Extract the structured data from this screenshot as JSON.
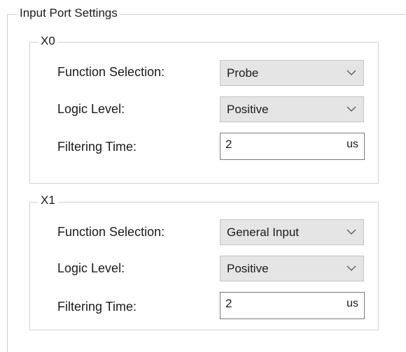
{
  "panel": {
    "title": "Input Port Settings"
  },
  "groups": [
    {
      "name": "X0",
      "function_label": "Function Selection:",
      "function_value": "Probe",
      "logic_label": "Logic Level:",
      "logic_value": "Positive",
      "filter_label": "Filtering Time:",
      "filter_value": "2",
      "filter_unit": "us"
    },
    {
      "name": "X1",
      "function_label": "Function Selection:",
      "function_value": "General Input",
      "logic_label": "Logic Level:",
      "logic_value": "Positive",
      "filter_label": "Filtering Time:",
      "filter_value": "2",
      "filter_unit": "us"
    }
  ],
  "icons": {
    "dropdown": "chevron-down-icon"
  },
  "colors": {
    "combo_bg": "#e5e5e5",
    "group_border": "#d3d3d3",
    "field_border": "#7a7a7a"
  }
}
